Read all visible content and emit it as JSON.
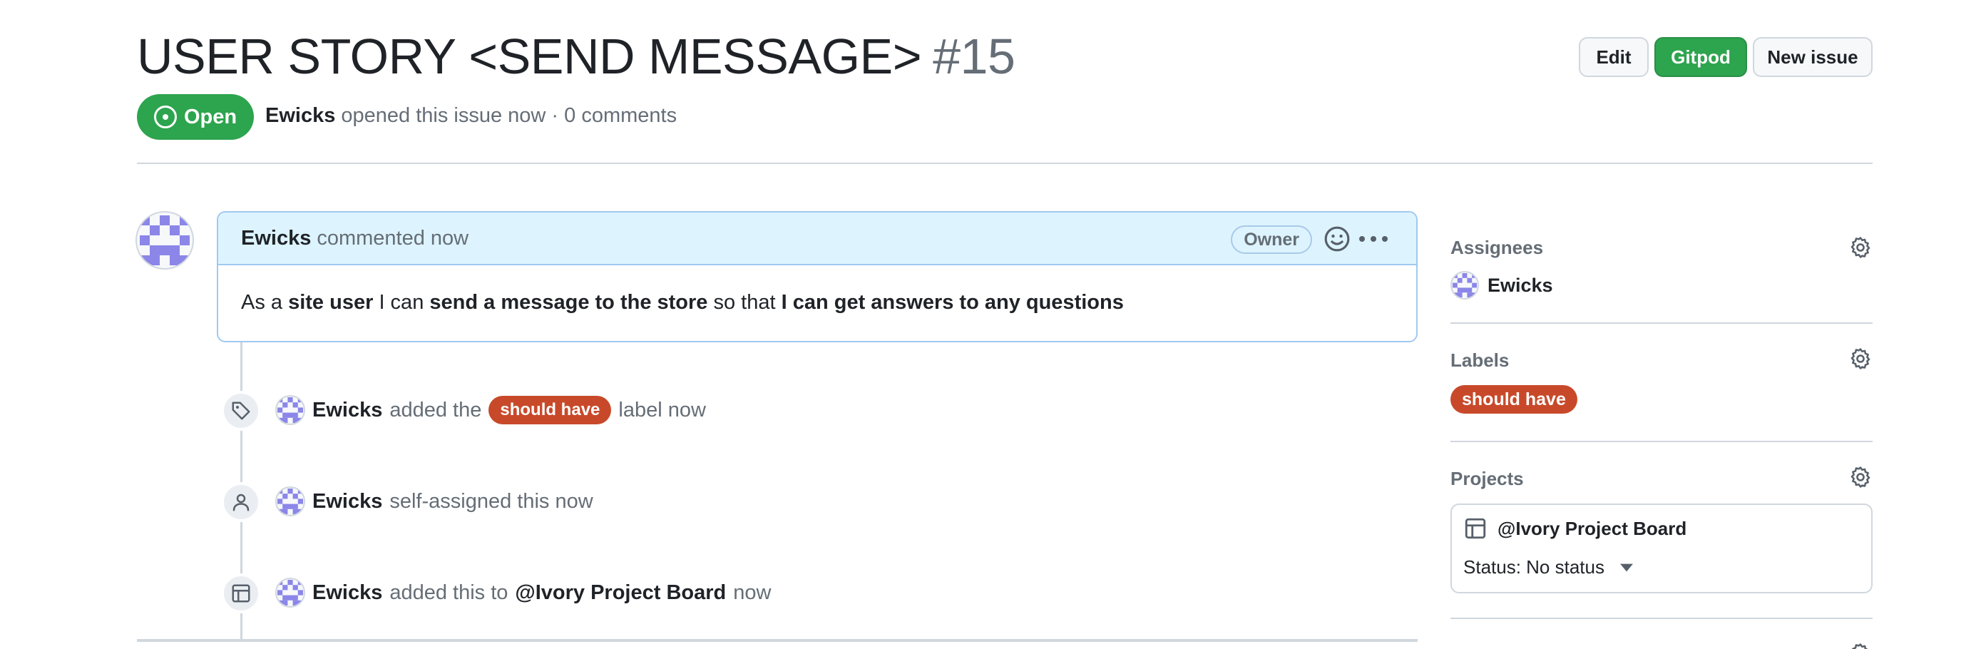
{
  "issue": {
    "title": "USER STORY <SEND MESSAGE>",
    "number": "#15",
    "state": "Open",
    "author": "Ewicks",
    "meta": "opened this issue now · 0 comments"
  },
  "header_buttons": {
    "edit": "Edit",
    "gitpod": "Gitpod",
    "new_issue": "New issue"
  },
  "comment": {
    "author": "Ewicks",
    "action": "commented now",
    "badge": "Owner",
    "body": {
      "p1": "As a ",
      "b1": "site user",
      "p2": " I can ",
      "b2": "send a message to the store",
      "p3": " so that ",
      "b3": "I can get answers to any questions"
    }
  },
  "timeline": [
    {
      "icon": "tag-icon",
      "actor": "Ewicks",
      "pre": "added the",
      "label": "should have",
      "post": "label now"
    },
    {
      "icon": "person-icon",
      "actor": "Ewicks",
      "pre": "self-assigned this now"
    },
    {
      "icon": "project-table-icon",
      "actor": "Ewicks",
      "pre": "added this to",
      "target": "@Ivory Project Board",
      "post": "now"
    }
  ],
  "sidebar": {
    "assignees": {
      "heading": "Assignees",
      "user": "Ewicks"
    },
    "labels": {
      "heading": "Labels",
      "label": "should have"
    },
    "projects": {
      "heading": "Projects",
      "name": "@Ivory Project Board",
      "status": "Status: No status"
    }
  },
  "colors": {
    "open_green": "#2da44e",
    "label_red": "#c8492a",
    "comment_header_bg": "#ddf4ff",
    "avatar_purple": "#8b86e8"
  }
}
